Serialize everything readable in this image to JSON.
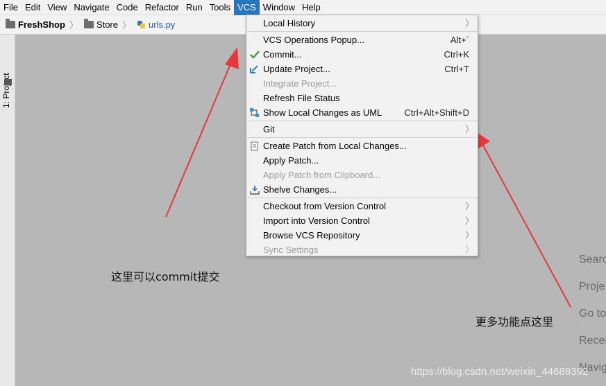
{
  "menubar": {
    "items": [
      "File",
      "Edit",
      "View",
      "Navigate",
      "Code",
      "Refactor",
      "Run",
      "Tools",
      "VCS",
      "Window",
      "Help"
    ],
    "active": "VCS"
  },
  "breadcrumb": {
    "project": "FreshShop",
    "folder": "Store",
    "file": "urls.py"
  },
  "toolwindow": {
    "project_label": "1: Project"
  },
  "vcs_menu": {
    "local_history": "Local History",
    "vcs_operations_popup": "VCS Operations Popup...",
    "vcs_operations_popup_shortcut": "Alt+`",
    "commit": "Commit...",
    "commit_shortcut": "Ctrl+K",
    "update_project": "Update Project...",
    "update_project_shortcut": "Ctrl+T",
    "integrate_project": "Integrate Project...",
    "refresh_file_status": "Refresh File Status",
    "show_local_changes_uml": "Show Local Changes as UML",
    "show_local_changes_uml_shortcut": "Ctrl+Alt+Shift+D",
    "git": "Git",
    "create_patch": "Create Patch from Local Changes...",
    "apply_patch": "Apply Patch...",
    "apply_patch_clipboard": "Apply Patch from Clipboard...",
    "shelve_changes": "Shelve Changes...",
    "checkout_vc": "Checkout from Version Control",
    "import_vc": "Import into Version Control",
    "browse_vcs_repo": "Browse VCS Repository",
    "sync_settings": "Sync Settings"
  },
  "editor_hints": [
    "Searc",
    "Proje",
    "Go to",
    "Recer",
    "Navig"
  ],
  "annotations": {
    "commit_note": "这里可以commit提交",
    "more_note": "更多功能点这里"
  },
  "watermark": "https://blog.csdn.net/weixin_44689392",
  "colors": {
    "accent": "#2675bf",
    "arrow": "#e8373a",
    "check": "#3f9b3f",
    "update": "#2f7fd1"
  }
}
